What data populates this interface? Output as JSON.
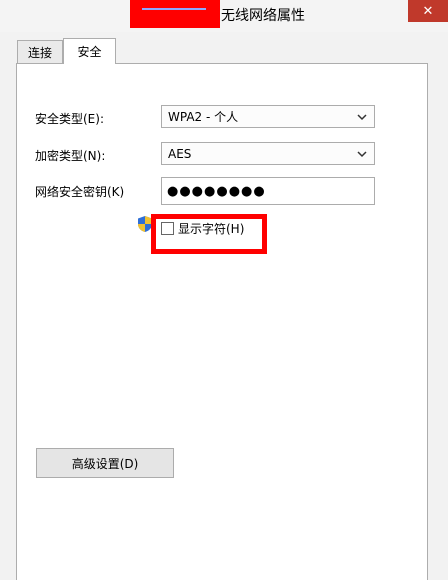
{
  "window": {
    "title": "无线网络属性",
    "close_label": "✕"
  },
  "tabs": [
    {
      "label": "连接",
      "active": false
    },
    {
      "label": "安全",
      "active": true
    }
  ],
  "security": {
    "security_type_label": "安全类型(E):",
    "security_type_value": "WPA2 - 个人",
    "encryption_type_label": "加密类型(N):",
    "encryption_type_value": "AES",
    "network_key_label": "网络安全密钥(K)",
    "network_key_value": "●●●●●●●●",
    "show_characters_label": "显示字符(H)",
    "show_characters_checked": false
  },
  "advanced_button_label": "高级设置(D)",
  "colors": {
    "highlight": "#ff0000",
    "redaction": "#ff0000",
    "close_button": "#c0392b"
  },
  "icons": {
    "uac": "uac-shield-icon",
    "dropdown": "chevron-down-icon"
  }
}
